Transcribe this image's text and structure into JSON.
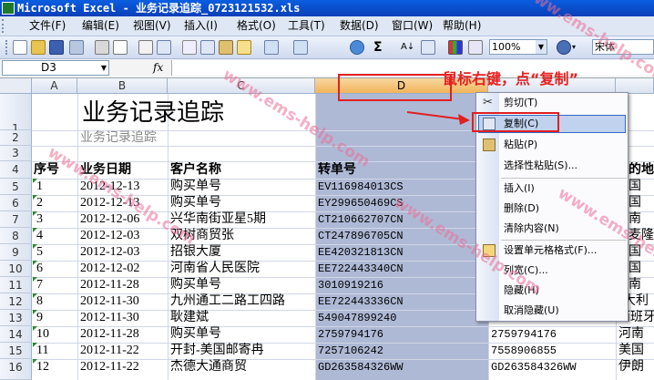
{
  "window": {
    "title": "Microsoft Excel - 业务记录追踪_0723121532.xls"
  },
  "menu": [
    "文件(F)",
    "编辑(E)",
    "视图(V)",
    "插入(I)",
    "格式(O)",
    "工具(T)",
    "数据(D)",
    "窗口(W)",
    "帮助(H)"
  ],
  "toolbar": {
    "zoom": "100%",
    "font": "宋体",
    "sigma": "Σ",
    "sort": "A↓"
  },
  "formula_bar": {
    "cell_ref": "D3",
    "fx_label": "fx",
    "value": ""
  },
  "columns": [
    "A",
    "B",
    "C",
    "D"
  ],
  "rows": [
    "1",
    "2",
    "3",
    "4",
    "5",
    "6",
    "7",
    "8",
    "9",
    "10",
    "11",
    "12",
    "13",
    "14",
    "15",
    "16"
  ],
  "sheet": {
    "title": "业务记录追踪",
    "subtitle": "业务记录追踪",
    "headers": {
      "a": "序号",
      "b": "业务日期",
      "c": "客户名称",
      "d": "转单号",
      "f": "的地"
    },
    "records": [
      {
        "no": "1",
        "date": "2012-12-13",
        "customer": "购买单号",
        "tracking": "EV116984013CS",
        "f_mono": "",
        "f": "国"
      },
      {
        "no": "2",
        "date": "2012-12-13",
        "customer": "购买单号",
        "tracking": "EY299650469CS",
        "f_mono": "",
        "f": "国"
      },
      {
        "no": "3",
        "date": "2012-12-06",
        "customer": "兴华南街亚星5期",
        "tracking": "CT210662707CN",
        "f_mono": "",
        "f": "南"
      },
      {
        "no": "4",
        "date": "2012-12-03",
        "customer": "双树商贸张",
        "tracking": "CT247896705CN",
        "f_mono": "",
        "f": "麦隆"
      },
      {
        "no": "5",
        "date": "2012-12-03",
        "customer": "招银大厦",
        "tracking": "EE420321813CN",
        "f_mono": "",
        "f": "国"
      },
      {
        "no": "6",
        "date": "2012-12-02",
        "customer": "河南省人民医院",
        "tracking": "EE722443340CN",
        "f_mono": "",
        "f": "国"
      },
      {
        "no": "7",
        "date": "2012-11-28",
        "customer": "购买单号",
        "tracking": "3010919216",
        "f_mono": "",
        "f": "南"
      },
      {
        "no": "8",
        "date": "2012-11-30",
        "customer": "九州通工二路工四路",
        "tracking": "EE722443336CN",
        "f_mono": "",
        "f": "大利"
      },
      {
        "no": "9",
        "date": "2012-11-30",
        "customer": "耿建斌",
        "tracking": "549047899240",
        "f_mono": "549047899240",
        "f": "西班牙"
      },
      {
        "no": "10",
        "date": "2012-11-28",
        "customer": "购买单号",
        "tracking": "2759794176",
        "f_mono": "2759794176",
        "f": "河南"
      },
      {
        "no": "11",
        "date": "2012-11-22",
        "customer": "开封-美国邮寄冉",
        "tracking": "7257106242",
        "f_mono": "7558906855",
        "f": "美国"
      },
      {
        "no": "12",
        "date": "2012-11-22",
        "customer": "杰德大通商贸",
        "tracking": "GD263584326WW",
        "f_mono": "GD263584326WW",
        "f": "伊朗"
      }
    ]
  },
  "context_menu": {
    "items": [
      "剪切(T)",
      "复制(C)",
      "粘贴(P)",
      "选择性粘贴(S)...",
      "插入(I)",
      "删除(D)",
      "清除内容(N)",
      "设置单元格格式(F)...",
      "列宽(C)...",
      "隐藏(H)",
      "取消隐藏(U)"
    ],
    "highlighted_index": 1
  },
  "annotation": {
    "text": "鼠标右键，点“复制”"
  },
  "watermark": "www.ems-help.com",
  "colors": {
    "title_bar": "#0b4fd0",
    "selection": "#aeb9d6",
    "annotation": "#e02020",
    "watermark": "#eb6e96"
  }
}
